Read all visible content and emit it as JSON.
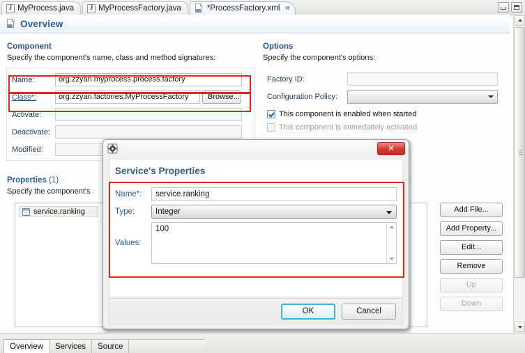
{
  "editor_tabs": [
    {
      "label": "MyProcess.java",
      "icon": "java-file-icon",
      "active": false,
      "closable": false
    },
    {
      "label": "MyProcessFactory.java",
      "icon": "java-file-icon",
      "active": false,
      "closable": false
    },
    {
      "label": "*ProcessFactory.xml",
      "icon": "xml-file-icon",
      "active": true,
      "closable": true,
      "close_glyph": "✕"
    }
  ],
  "window_controls": {
    "minimize": "minimize-icon",
    "maximize": "maximize-icon"
  },
  "form_header": {
    "title": "Overview",
    "icon": "overview-page-icon"
  },
  "component": {
    "title": "Component",
    "description": "Specify the component's name, class and method signatures:",
    "fields": [
      {
        "label": "Name:",
        "value": "org.zzyan.myprocess.process.factory",
        "link": false,
        "button": null
      },
      {
        "label": "Class*:",
        "value": "org.zzyan.factories.MyProcessFactory",
        "link": true,
        "button": "Browse..."
      },
      {
        "label": "Activate:",
        "value": "",
        "link": false,
        "button": null
      },
      {
        "label": "Deactivate:",
        "value": "",
        "link": false,
        "button": null
      },
      {
        "label": "Modified:",
        "value": "",
        "link": false,
        "button": null
      }
    ]
  },
  "options": {
    "title": "Options",
    "description": "Specify the component's options:",
    "factory_id": {
      "label": "Factory ID:",
      "value": ""
    },
    "configuration_policy": {
      "label": "Configuration Policy:",
      "value": ""
    },
    "checkboxes": [
      {
        "label": "This component is enabled when started",
        "checked": true,
        "disabled": false
      },
      {
        "label": "This component is immediately activated",
        "checked": false,
        "disabled": true
      }
    ]
  },
  "properties": {
    "title": "Properties",
    "count": "(1)",
    "description": "Specify the component's",
    "items": [
      {
        "label": "service.ranking",
        "icon": "property-icon"
      }
    ],
    "buttons": [
      {
        "label": "Add File...",
        "disabled": false
      },
      {
        "label": "Add Property...",
        "disabled": false
      },
      {
        "label": "Edit...",
        "disabled": false
      },
      {
        "label": "Remove",
        "disabled": false
      },
      {
        "label": "Up",
        "disabled": true
      },
      {
        "label": "Down",
        "disabled": true
      }
    ]
  },
  "dialog": {
    "icon": "gear-icon",
    "close_label": "✕",
    "heading": "Service's Properties",
    "name": {
      "label": "Name*:",
      "value": "service.ranking"
    },
    "type": {
      "label": "Type:",
      "value": "Integer"
    },
    "values": {
      "label": "Values:",
      "value": "100"
    },
    "ok_label": "OK",
    "cancel_label": "Cancel"
  },
  "page_tabs": [
    {
      "label": "Overview",
      "active": true
    },
    {
      "label": "Services",
      "active": false
    },
    {
      "label": "Source",
      "active": false
    }
  ],
  "colors": {
    "accent": "#2b5a93",
    "highlight": "#e8231f",
    "close_red": "#d93a33",
    "focus_blue": "#3fb2e0"
  }
}
